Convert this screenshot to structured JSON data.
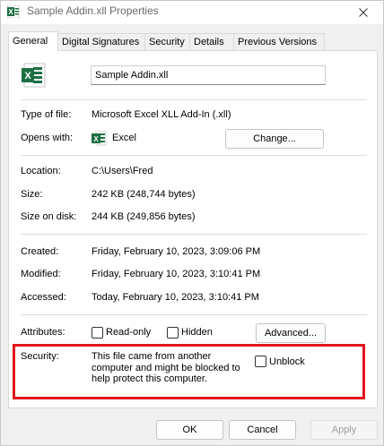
{
  "window": {
    "title": "Sample Addin.xll Properties"
  },
  "tabs": [
    {
      "label": "General",
      "active": true
    },
    {
      "label": "Digital Signatures",
      "active": false
    },
    {
      "label": "Security",
      "active": false
    },
    {
      "label": "Details",
      "active": false
    },
    {
      "label": "Previous Versions",
      "active": false
    }
  ],
  "file": {
    "name": "Sample Addin.xll"
  },
  "info": {
    "type_label": "Type of file:",
    "type_value": "Microsoft Excel XLL Add-In (.xll)",
    "opens_label": "Opens with:",
    "opens_value": "Excel",
    "change_button": "Change...",
    "location_label": "Location:",
    "location_value": "C:\\Users\\Fred",
    "size_label": "Size:",
    "size_value": "242 KB (248,744 bytes)",
    "size_disk_label": "Size on disk:",
    "size_disk_value": "244 KB (249,856 bytes)",
    "created_label": "Created:",
    "created_value": "Friday, February 10, 2023, 3:09:06 PM",
    "modified_label": "Modified:",
    "modified_value": "Friday, February 10, 2023, 3:10:41 PM",
    "accessed_label": "Accessed:",
    "accessed_value": "Today, February 10, 2023, 3:10:41 PM"
  },
  "attributes": {
    "label": "Attributes:",
    "readonly": "Read-only",
    "hidden": "Hidden",
    "advanced_button": "Advanced..."
  },
  "security": {
    "label": "Security:",
    "message": "This file came from another computer and might be blocked to help protect this computer.",
    "unblock": "Unblock",
    "highlight_color": "#e2151b"
  },
  "footer": {
    "ok": "OK",
    "cancel": "Cancel",
    "apply": "Apply"
  },
  "colors": {
    "excel_green": "#1d6f42"
  }
}
